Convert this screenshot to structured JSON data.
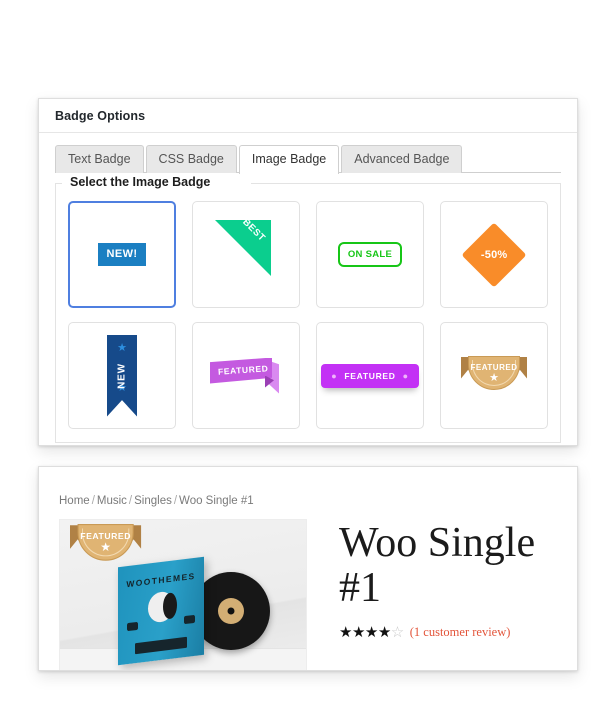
{
  "badge_panel": {
    "title": "Badge Options",
    "tabs": [
      {
        "label": "Text Badge",
        "active": false
      },
      {
        "label": "CSS Badge",
        "active": false
      },
      {
        "label": "Image Badge",
        "active": true
      },
      {
        "label": "Advanced Badge",
        "active": false
      }
    ],
    "fieldset_legend": "Select the Image Badge",
    "badges": [
      {
        "name": "new-rect-badge",
        "text": "NEW!",
        "color": "#1b7fc2",
        "selected": true
      },
      {
        "name": "best-corner-badge",
        "text": "BEST",
        "color": "#0bce8e",
        "selected": false
      },
      {
        "name": "on-sale-outline-badge",
        "text": "ON SALE",
        "color": "#17c617",
        "selected": false
      },
      {
        "name": "discount-diamond-badge",
        "text": "-50%",
        "color": "#f98c29",
        "selected": false
      },
      {
        "name": "new-vertical-ribbon-badge",
        "text": "NEW",
        "color": "#164a8a",
        "selected": false
      },
      {
        "name": "featured-folded-ribbon-badge",
        "text": "FEATURED",
        "color": "#c45ae0",
        "selected": false
      },
      {
        "name": "featured-pill-badge",
        "text": "FEATURED",
        "color": "#c331f5",
        "selected": false
      },
      {
        "name": "featured-gold-badge",
        "text": "FEATURED",
        "color": "#e0b473",
        "selected": false
      }
    ]
  },
  "product_panel": {
    "breadcrumb": [
      "Home",
      "Music",
      "Singles",
      "Woo Single #1"
    ],
    "breadcrumb_separator": "/",
    "title": "Woo Single #1",
    "image_badge_text": "FEATURED",
    "image_brand_text": "WOOTHEMES",
    "rating": {
      "filled": "★★★★",
      "empty": "☆",
      "review_text": "(1 customer review)",
      "review_color": "#e3553b"
    }
  }
}
